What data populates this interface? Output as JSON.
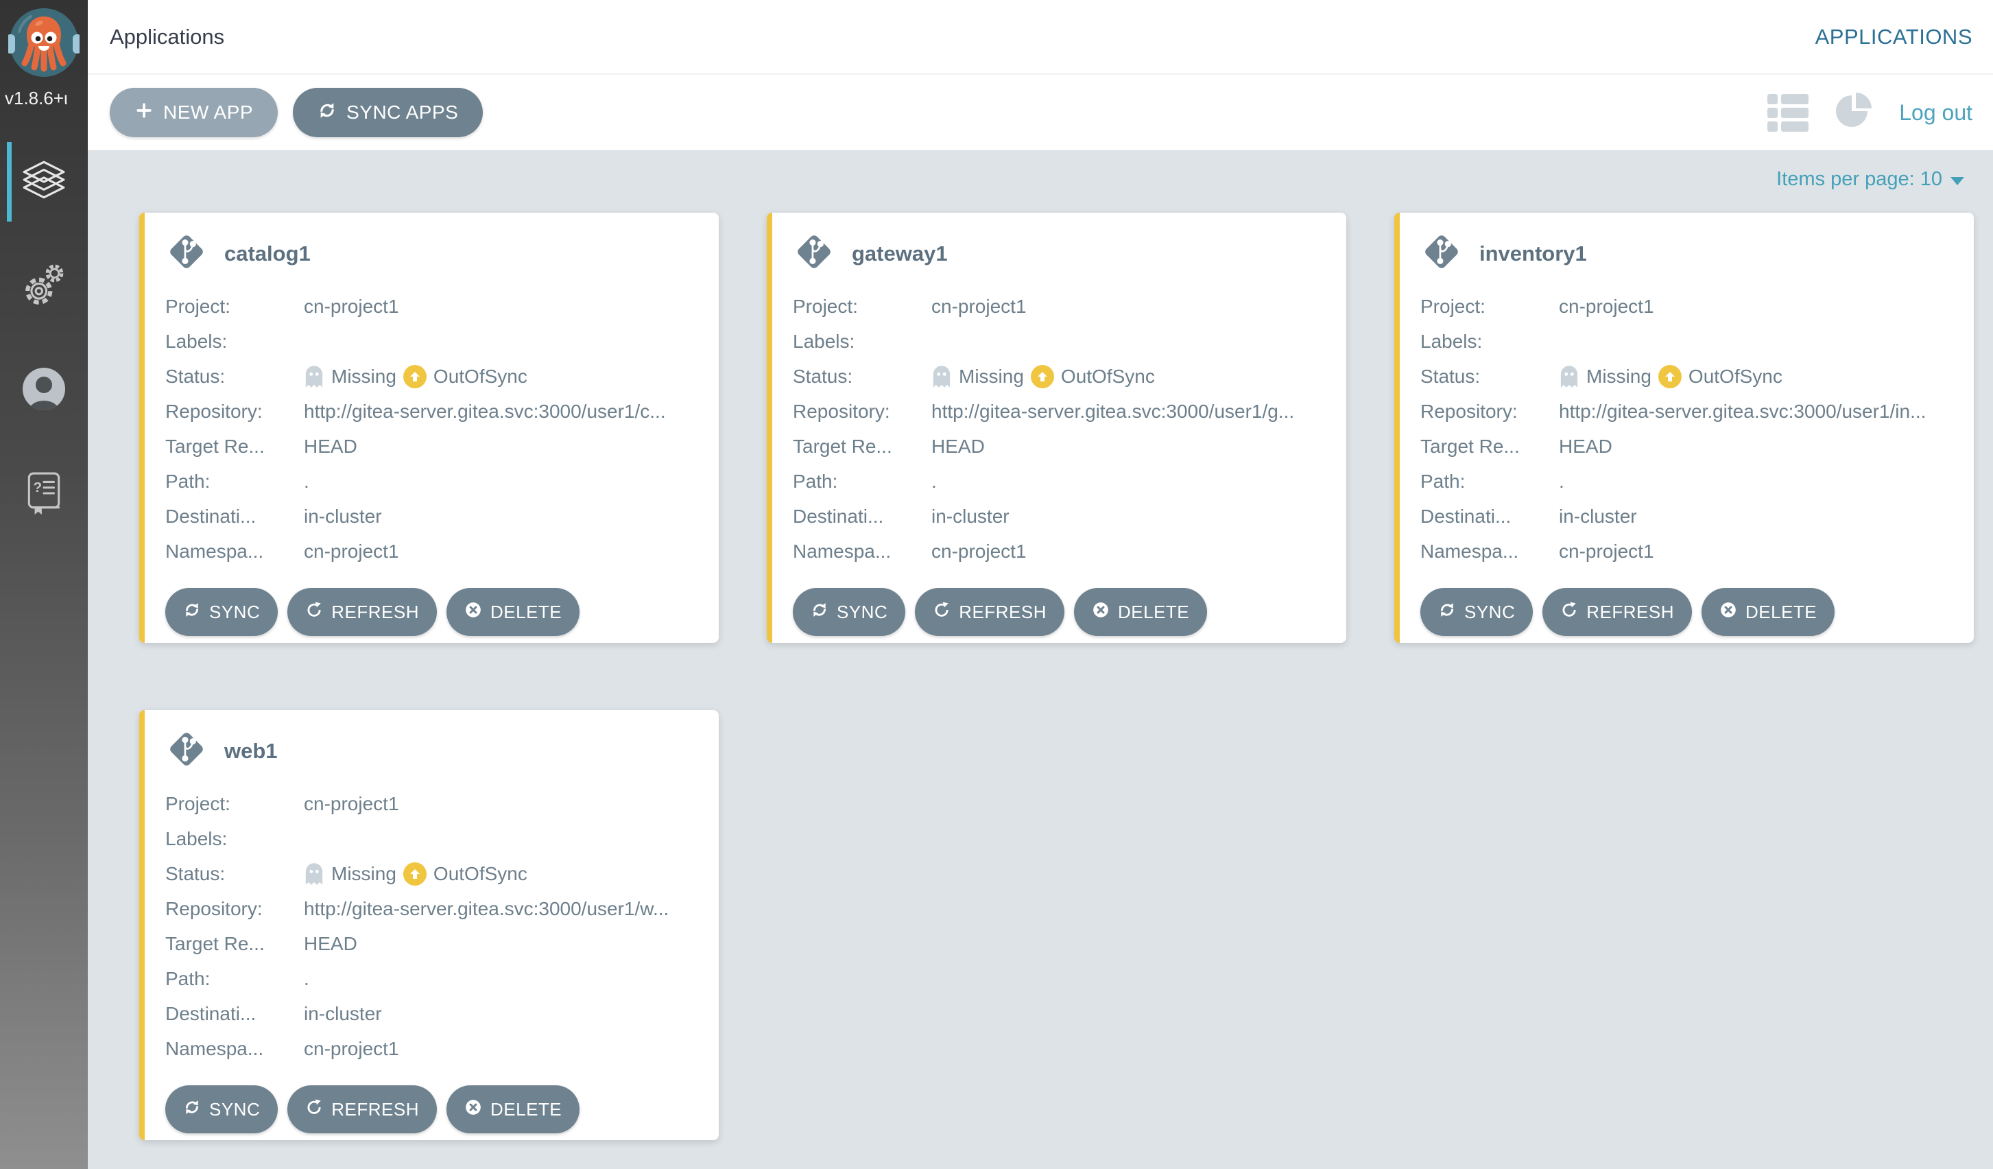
{
  "app": {
    "version": "v1.8.6+ι"
  },
  "sidebar": {
    "nav": [
      {
        "id": "applications",
        "icon": "layers-icon",
        "active": true
      },
      {
        "id": "settings",
        "icon": "gear-icon",
        "active": false
      },
      {
        "id": "user",
        "icon": "user-icon",
        "active": false
      },
      {
        "id": "help",
        "icon": "docs-icon",
        "active": false
      }
    ]
  },
  "header": {
    "breadcrumb": "Applications",
    "title": "APPLICATIONS"
  },
  "toolbar": {
    "new_app": "NEW APP",
    "sync_apps": "SYNC APPS",
    "logout": "Log out",
    "views": [
      "grid",
      "list",
      "pie"
    ],
    "active_view": "grid"
  },
  "content": {
    "items_per_page": "Items per page: 10"
  },
  "labels": {
    "project": "Project:",
    "labels": "Labels:",
    "status": "Status:",
    "repository": "Repository:",
    "target_revision": "Target Re...",
    "path": "Path:",
    "destination": "Destinati...",
    "namespace": "Namespa..."
  },
  "status": {
    "missing": "Missing",
    "out_of_sync": "OutOfSync"
  },
  "actions": {
    "sync": "SYNC",
    "refresh": "REFRESH",
    "delete": "DELETE"
  },
  "cards": [
    {
      "name": "catalog1",
      "project": "cn-project1",
      "labels": "",
      "repository": "http://gitea-server.gitea.svc:3000/user1/c...",
      "target_revision": "HEAD",
      "path": ".",
      "destination": "in-cluster",
      "namespace": "cn-project1"
    },
    {
      "name": "gateway1",
      "project": "cn-project1",
      "labels": "",
      "repository": "http://gitea-server.gitea.svc:3000/user1/g...",
      "target_revision": "HEAD",
      "path": ".",
      "destination": "in-cluster",
      "namespace": "cn-project1"
    },
    {
      "name": "inventory1",
      "project": "cn-project1",
      "labels": "",
      "repository": "http://gitea-server.gitea.svc:3000/user1/in...",
      "target_revision": "HEAD",
      "path": ".",
      "destination": "in-cluster",
      "namespace": "cn-project1"
    },
    {
      "name": "web1",
      "project": "cn-project1",
      "labels": "",
      "repository": "http://gitea-server.gitea.svc:3000/user1/w...",
      "target_revision": "HEAD",
      "path": ".",
      "destination": "in-cluster",
      "namespace": "cn-project1"
    }
  ],
  "colors": {
    "accent_teal": "#4db3c8",
    "link_teal": "#4aa3bc",
    "sidebar_active": "#4ab9d1",
    "card_border_yellow": "#f1c43f",
    "status_warning": "#f0c53f",
    "button_gray": "#6f8290",
    "button_gray_light": "#97a6b3",
    "title_teal_dark": "#2b7095",
    "text_gray": "#6d7f8b",
    "heading_dark": "#363c4a",
    "content_bg": "#dde3e7"
  }
}
